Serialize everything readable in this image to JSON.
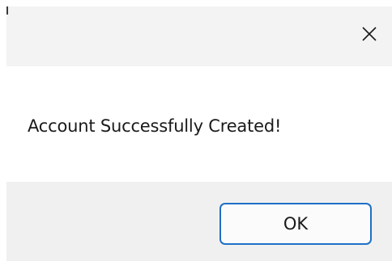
{
  "dialog": {
    "close_icon": "close-icon",
    "message": "Account Successfully Created!",
    "ok_label": "OK"
  },
  "colors": {
    "title_bar": "#f3f3f3",
    "footer": "#f0f0f0",
    "button_border": "#1f6fc7"
  }
}
